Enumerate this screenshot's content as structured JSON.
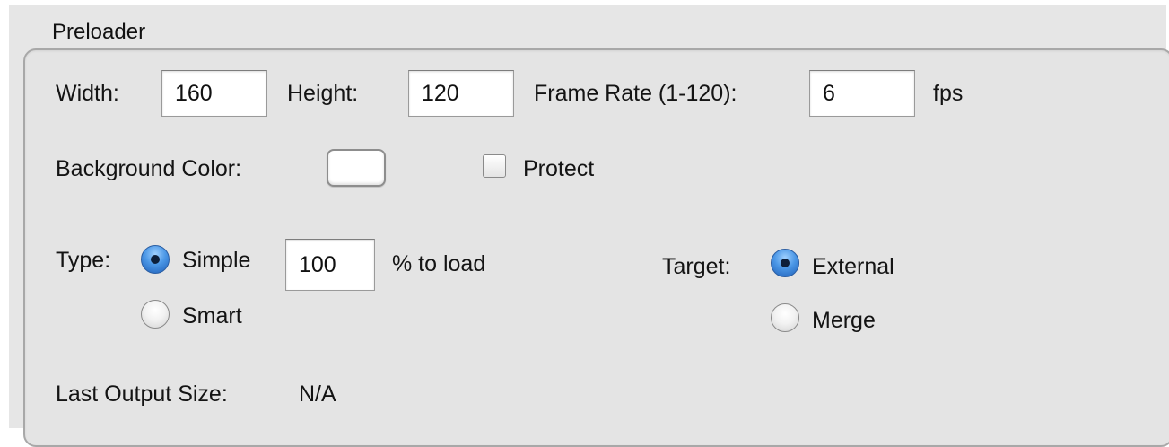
{
  "group": {
    "title": "Preloader"
  },
  "dimensions": {
    "width_label": "Width:",
    "width_value": "160",
    "height_label": "Height:",
    "height_value": "120",
    "frame_rate_label": "Frame Rate (1-120):",
    "frame_rate_value": "6",
    "frame_rate_unit": "fps"
  },
  "background": {
    "label": "Background Color:",
    "color": "#ffffff"
  },
  "protect": {
    "label": "Protect",
    "checked": false
  },
  "type": {
    "label": "Type:",
    "options": [
      {
        "label": "Simple",
        "selected": true
      },
      {
        "label": "Smart",
        "selected": false
      }
    ],
    "load_value": "100",
    "load_unit": "% to load"
  },
  "target": {
    "label": "Target:",
    "options": [
      {
        "label": "External",
        "selected": true
      },
      {
        "label": "Merge",
        "selected": false
      }
    ]
  },
  "output": {
    "label": "Last Output Size:",
    "value": "N/A"
  },
  "colors": {
    "panel": "#e4e4e4",
    "radio_selected": "#3d86db"
  }
}
